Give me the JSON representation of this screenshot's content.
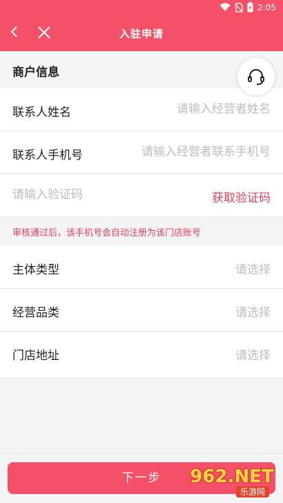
{
  "status_bar": {
    "time": "2:05"
  },
  "app_bar": {
    "title": "入驻申请"
  },
  "section": {
    "title": "商户信息"
  },
  "form": {
    "contact_name": {
      "label": "联系人姓名",
      "placeholder": "请输入经营者姓名"
    },
    "contact_phone": {
      "label": "联系人手机号",
      "placeholder": "请输入经营者联系手机号"
    },
    "verify_code": {
      "placeholder": "请输入验证码",
      "action": "获取验证码"
    },
    "notice": "审核通过后，该手机号会自动注册为该门店账号",
    "entity_type": {
      "label": "主体类型",
      "value": "请选择"
    },
    "category": {
      "label": "经营品类",
      "value": "请选择"
    },
    "store_address": {
      "label": "门店地址",
      "value": "请选择"
    }
  },
  "next_button": {
    "label": "下一步"
  },
  "watermark": {
    "brand": "962.NET",
    "sub": "乐游网"
  },
  "colors": {
    "accent": "#f5506a",
    "link": "#e8405a",
    "placeholder": "#bdbdbd"
  }
}
